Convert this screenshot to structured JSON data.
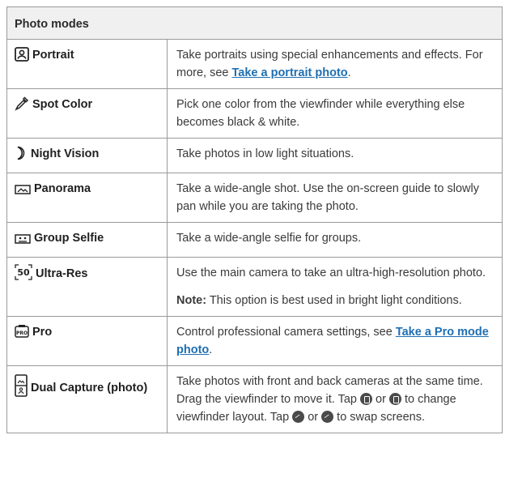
{
  "table": {
    "header": "Photo modes",
    "rows": [
      {
        "icon": "portrait-icon",
        "mode": "Portrait",
        "desc": {
          "text": "Take portraits using special enhancements and effects. For more, see ",
          "link": "Take a portrait photo",
          "after": "."
        }
      },
      {
        "icon": "eyedropper-icon",
        "mode": "Spot Color",
        "desc": {
          "text": "Pick one color from the viewfinder while everything else becomes black & white."
        }
      },
      {
        "icon": "moon-icon",
        "mode": "Night Vision",
        "desc": {
          "text": "Take photos in low light situations."
        }
      },
      {
        "icon": "panorama-icon",
        "mode": "Panorama",
        "desc": {
          "text": "Take a wide-angle shot. Use the on-screen guide to slowly pan while you are taking the photo."
        }
      },
      {
        "icon": "group-selfie-icon",
        "mode": "Group Selfie",
        "desc": {
          "text": "Take a wide-angle selfie for groups."
        }
      },
      {
        "icon": "ultra-res-icon",
        "mode": "Ultra-Res",
        "desc": {
          "text": "Use the main camera to take an ultra-high-resolution photo.",
          "note_label": "Note:",
          "note_text": " This option is best used in bright light conditions."
        }
      },
      {
        "icon": "pro-icon",
        "mode": "Pro",
        "desc": {
          "text": "Control professional camera settings, see ",
          "link": "Take a Pro mode photo",
          "after": "."
        }
      },
      {
        "icon": "dual-capture-icon",
        "mode": "Dual Capture (photo)",
        "desc": {
          "text1": "Take photos with front and back cameras at the same time. Drag the viewfinder to move it. Tap ",
          "or1": " or ",
          "text2": " to change viewfinder layout. Tap ",
          "or2": " or ",
          "text3": " to swap screens."
        }
      }
    ]
  }
}
